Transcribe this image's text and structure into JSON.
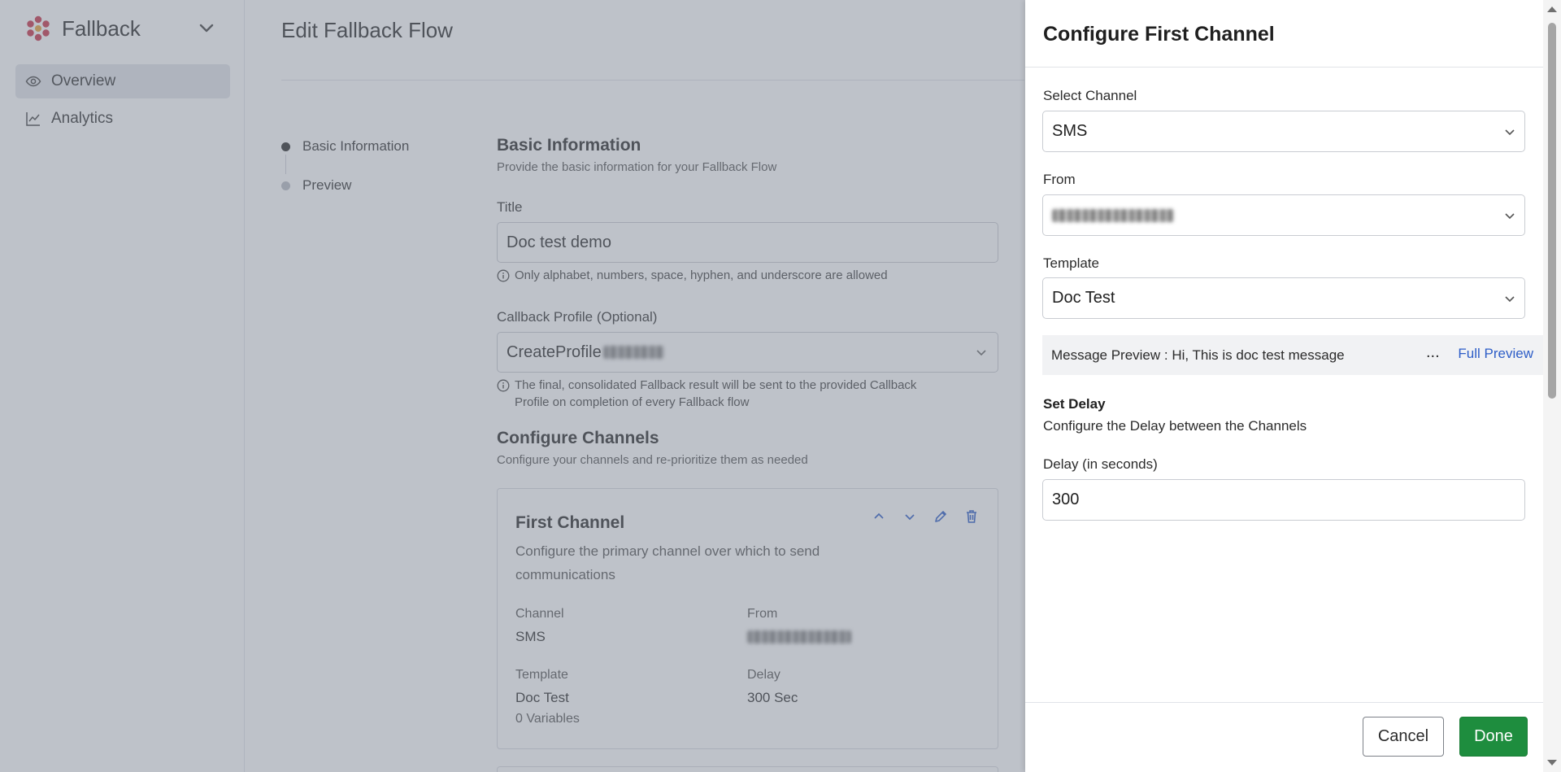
{
  "sidebar": {
    "brand": "Fallback",
    "items": [
      {
        "label": "Overview",
        "icon": "eye-icon",
        "active": true
      },
      {
        "label": "Analytics",
        "icon": "chart-line-icon",
        "active": false
      }
    ]
  },
  "main": {
    "page_title": "Edit Fallback Flow",
    "steps": [
      {
        "label": "Basic Information",
        "current": true
      },
      {
        "label": "Preview",
        "current": false
      }
    ],
    "basic_info": {
      "heading": "Basic Information",
      "subheading": "Provide the basic information for your Fallback Flow",
      "title_label": "Title",
      "title_value": "Doc test demo",
      "title_hint": "Only alphabet, numbers, space, hyphen, and underscore are allowed",
      "callback_label": "Callback Profile (Optional)",
      "callback_value": "CreateProfile",
      "callback_hint": "The final, consolidated Fallback result will be sent to the provided Callback Profile on completion of every Fallback flow"
    },
    "channels": {
      "heading": "Configure Channels",
      "subheading": "Configure your channels and re-prioritize them as needed",
      "first_channel": {
        "title": "First Channel",
        "description": "Configure the primary channel over which to send communications",
        "channel_label": "Channel",
        "channel_value": "SMS",
        "from_label": "From",
        "template_label": "Template",
        "template_value": "Doc Test",
        "variables": "0 Variables",
        "delay_label": "Delay",
        "delay_value": "300 Sec"
      }
    }
  },
  "drawer": {
    "title": "Configure First Channel",
    "select_channel_label": "Select Channel",
    "select_channel_value": "SMS",
    "from_label": "From",
    "template_label": "Template",
    "template_value": "Doc Test",
    "message_preview": "Message Preview : Hi, This is doc test message",
    "ellipsis": "...",
    "full_preview_link": "Full Preview",
    "set_delay_heading": "Set Delay",
    "set_delay_desc": "Configure the Delay between the Channels",
    "delay_label": "Delay (in seconds)",
    "delay_value": "300",
    "cancel_label": "Cancel",
    "done_label": "Done"
  },
  "colors": {
    "accent_blue": "#2d5dc7",
    "done_green": "#1e8d3e",
    "overlay": "#78808e"
  }
}
